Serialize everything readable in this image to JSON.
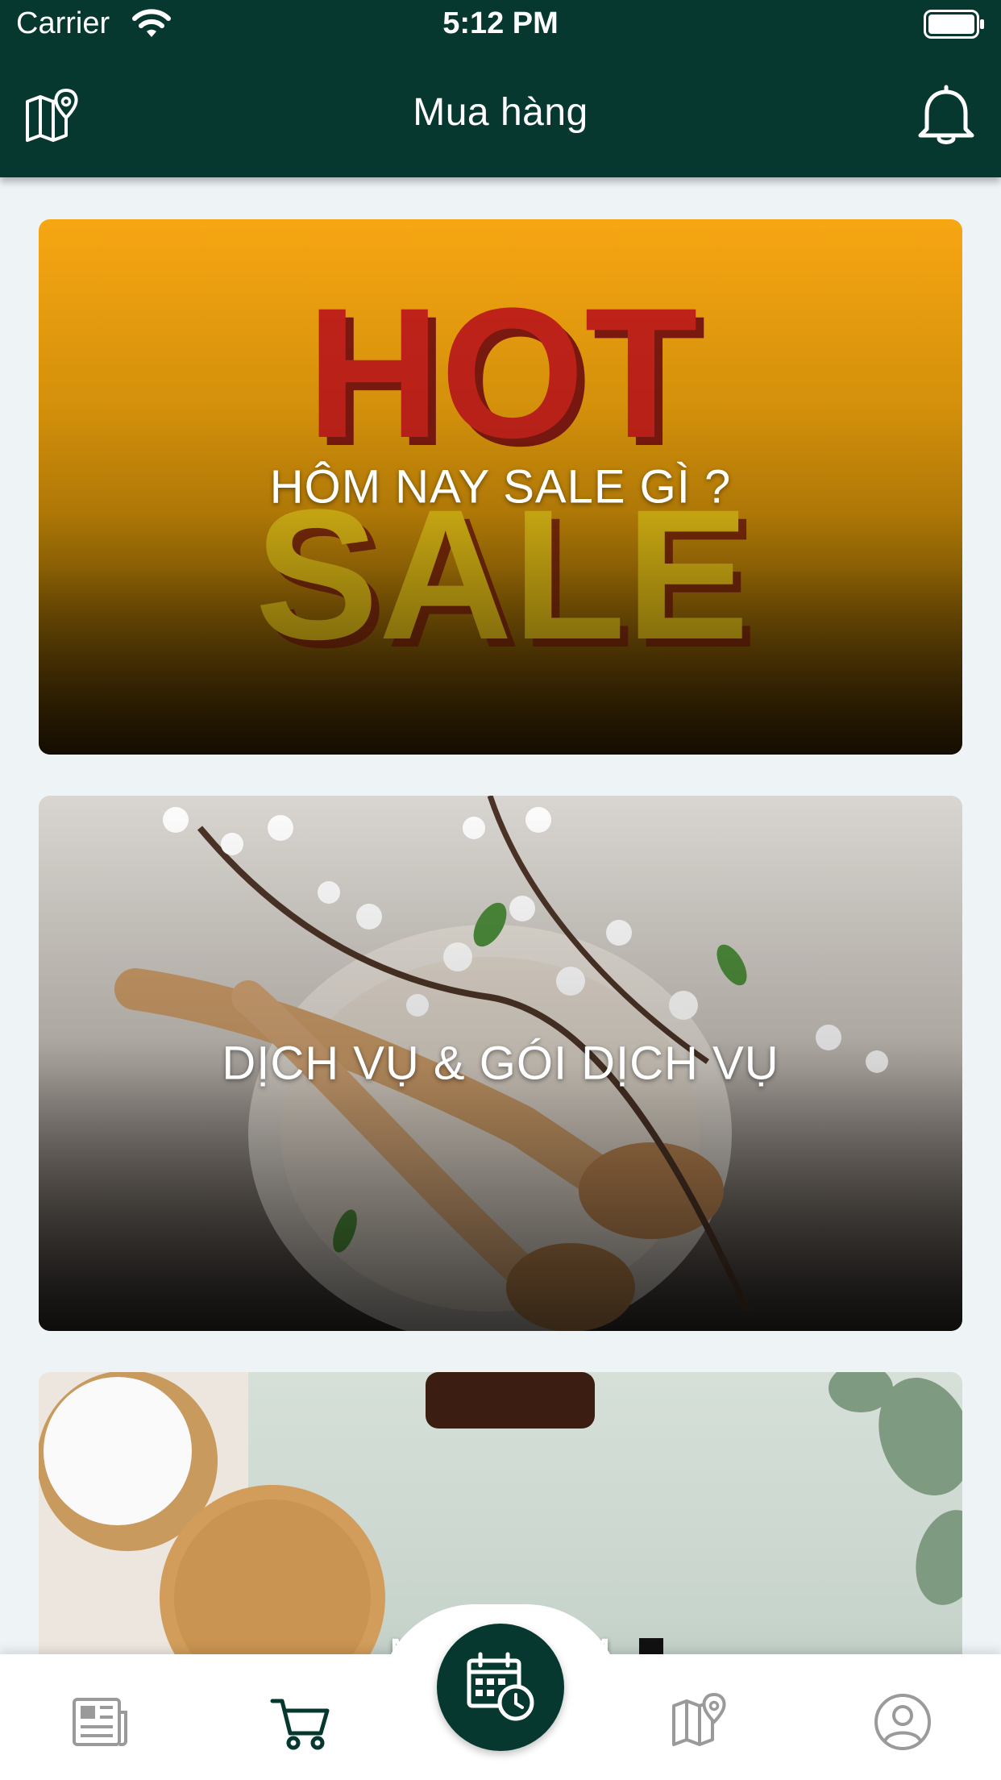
{
  "status_bar": {
    "carrier": "Carrier",
    "time": "5:12 PM"
  },
  "header": {
    "title": "Mua hàng",
    "left_icon": "map-pin-icon",
    "right_icon": "bell-icon"
  },
  "cards": [
    {
      "label": "HÔM NAY SALE GÌ ?"
    },
    {
      "label": "DỊCH VỤ & GÓI DỊCH VỤ"
    },
    {
      "label": "MỸ PHẨM"
    }
  ],
  "tab_bar": {
    "items": [
      {
        "icon": "newspaper-icon",
        "active": false
      },
      {
        "icon": "cart-icon",
        "active": true
      },
      {
        "icon": "calendar-clock-icon",
        "active": false,
        "center": true
      },
      {
        "icon": "map-icon",
        "active": false
      },
      {
        "icon": "profile-icon",
        "active": false
      }
    ]
  },
  "colors": {
    "primary": "#063830",
    "background": "#eef3f6",
    "inactive_icon": "#9a9a9a"
  }
}
